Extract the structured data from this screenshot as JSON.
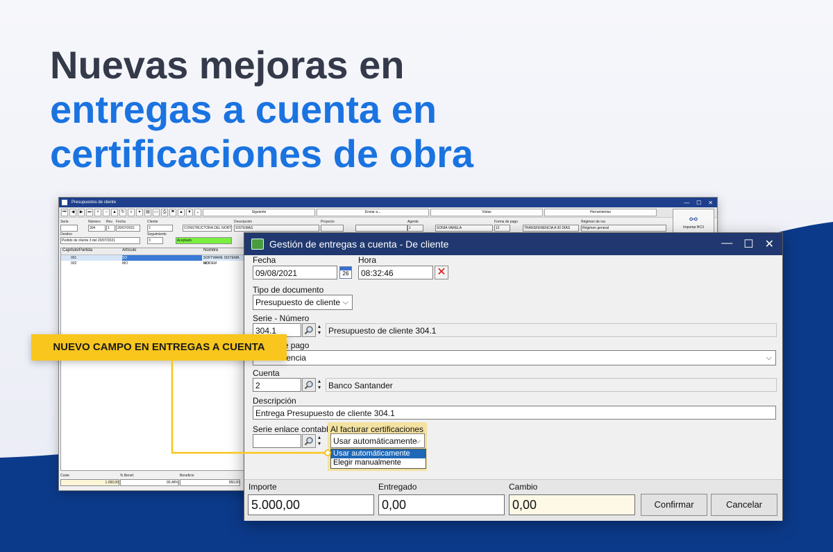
{
  "headline": {
    "line1": "Nuevas mejoras en",
    "line2": "entregas a cuenta en",
    "line3": "certificaciones de obra"
  },
  "callout": {
    "label": "NUEVO CAMPO EN ENTREGAS A CUENTA"
  },
  "back_window": {
    "title": "Presupuestos de cliente",
    "toolbar": {
      "siguiente": "Siguiente",
      "enviar": "Enviar a...",
      "vistas": "Vistas",
      "herramientas": "Herramientas"
    },
    "labels": {
      "serie": "Serie",
      "numero": "Número",
      "rev": "Rev.",
      "fecha": "Fecha",
      "cliente": "Cliente",
      "descripcion": "Descripción",
      "proyecto": "Proyecto",
      "agente": "Agente",
      "forma_pago": "Forma de pago",
      "regimen_iva": "Régimen de iva",
      "destino": "Destino",
      "seguimiento": "Seguimiento"
    },
    "values": {
      "numero": "304",
      "rev": "1",
      "fecha": "20/07/2021",
      "cliente_code": "2",
      "cliente_name": "CONSTRUCTORA DEL NORT",
      "descripcion": "SISTEMAS",
      "agente_code": "1",
      "agente_name": "SONIA VARELA",
      "forma_pago_code": "12",
      "forma_pago_name": "TRANSFERENCIA A 30 DÍAS",
      "regimen_iva": "Régimen general",
      "destino": "Pedido de cliente 3 del 20/07/2021",
      "seguimiento_code": "3",
      "seguimiento_status": "Aceptado"
    },
    "import_label": "Importar BC3",
    "grid_headers": [
      "Capítulo/Partida",
      "Artículo",
      "Nombre"
    ],
    "grid_rows": [
      {
        "capitulo": "001",
        "articulo": "SO",
        "nombre": "SOFTWARE SISTEMA MO"
      },
      {
        "capitulo": "002",
        "articulo": "MO",
        "nombre": "MODEM"
      }
    ],
    "footer": {
      "coste_label": "Coste",
      "coste_value": "1.050,00",
      "benef_pct_label": "% Benef.",
      "benef_pct_value": "90,48%",
      "beneficio_label": "Beneficio",
      "beneficio_value": "950,00"
    }
  },
  "dialog": {
    "title": "Gestión de entregas a cuenta - De cliente",
    "fecha": {
      "label": "Fecha",
      "value": "09/08/2021"
    },
    "calendar_day": "26",
    "hora": {
      "label": "Hora",
      "value": "08:32:46"
    },
    "tipo_documento": {
      "label": "Tipo de documento",
      "value": "Presupuesto de cliente"
    },
    "serie_numero": {
      "label": "Serie - Número",
      "value": "304.1",
      "description": "Presupuesto de cliente 304.1"
    },
    "forma_pago": {
      "label_visible": "rma de pago",
      "value_visible": "encia"
    },
    "cuenta": {
      "label": "Cuenta",
      "value": "2",
      "description": "Banco Santander"
    },
    "descripcion": {
      "label": "Descripción",
      "value": "Entrega Presupuesto de cliente 304.1"
    },
    "serie_enlace": {
      "label": "Serie enlace contable",
      "value": ""
    },
    "al_facturar": {
      "label": "Al facturar certificaciones",
      "value": "Usar automáticamente",
      "options": [
        "Usar automáticamente",
        "Elegir manualmente"
      ]
    },
    "importe": {
      "label": "Importe",
      "value": "5.000,00"
    },
    "entregado": {
      "label": "Entregado",
      "value": "0,00"
    },
    "cambio": {
      "label": "Cambio",
      "value": "0,00"
    },
    "confirm_label": "Confirmar",
    "cancel_label": "Cancelar"
  },
  "colors": {
    "title_bar": "#20386f",
    "accent_blue": "#1a73e0",
    "callout_yellow": "#f8c61d",
    "navy_wave": "#0c3a8a"
  }
}
